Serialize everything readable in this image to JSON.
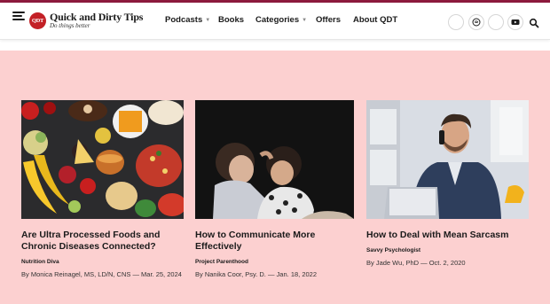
{
  "site": {
    "logo_badge": "QDT",
    "logo_title": "Quick and Dirty Tips",
    "logo_tagline": "Do things better"
  },
  "nav": {
    "items": [
      {
        "label": "Podcasts",
        "dropdown": true
      },
      {
        "label": "Books",
        "dropdown": false
      },
      {
        "label": "Categories",
        "dropdown": true
      },
      {
        "label": "Offers",
        "dropdown": false
      },
      {
        "label": "About QDT",
        "dropdown": false
      }
    ],
    "social_icons": [
      "facebook-icon",
      "spotify-icon",
      "apple-icon",
      "youtube-icon"
    ],
    "search_icon": "search-icon"
  },
  "articles": [
    {
      "title": "Are Ultra Processed Foods and Chronic Diseases Connected?",
      "category": "Nutrition Diva",
      "meta": "By Monica Reinagel, MS, LD/N, CNS — Mar. 25, 2024",
      "image": "processed-foods-image"
    },
    {
      "title": "How to Communicate More Effectively",
      "category": "Project Parenthood",
      "meta": "By Nanika Coor, Psy. D. — Jan. 18, 2022",
      "image": "parent-child-image"
    },
    {
      "title": "How to Deal with Mean Sarcasm",
      "category": "Savvy Psychologist",
      "meta": "By Jade Wu, PhD — Oct. 2, 2020",
      "image": "man-on-phone-image"
    }
  ],
  "colors": {
    "brand": "#8d1b3d",
    "logo_red": "#c32026",
    "section_bg": "#fcd0d0"
  }
}
